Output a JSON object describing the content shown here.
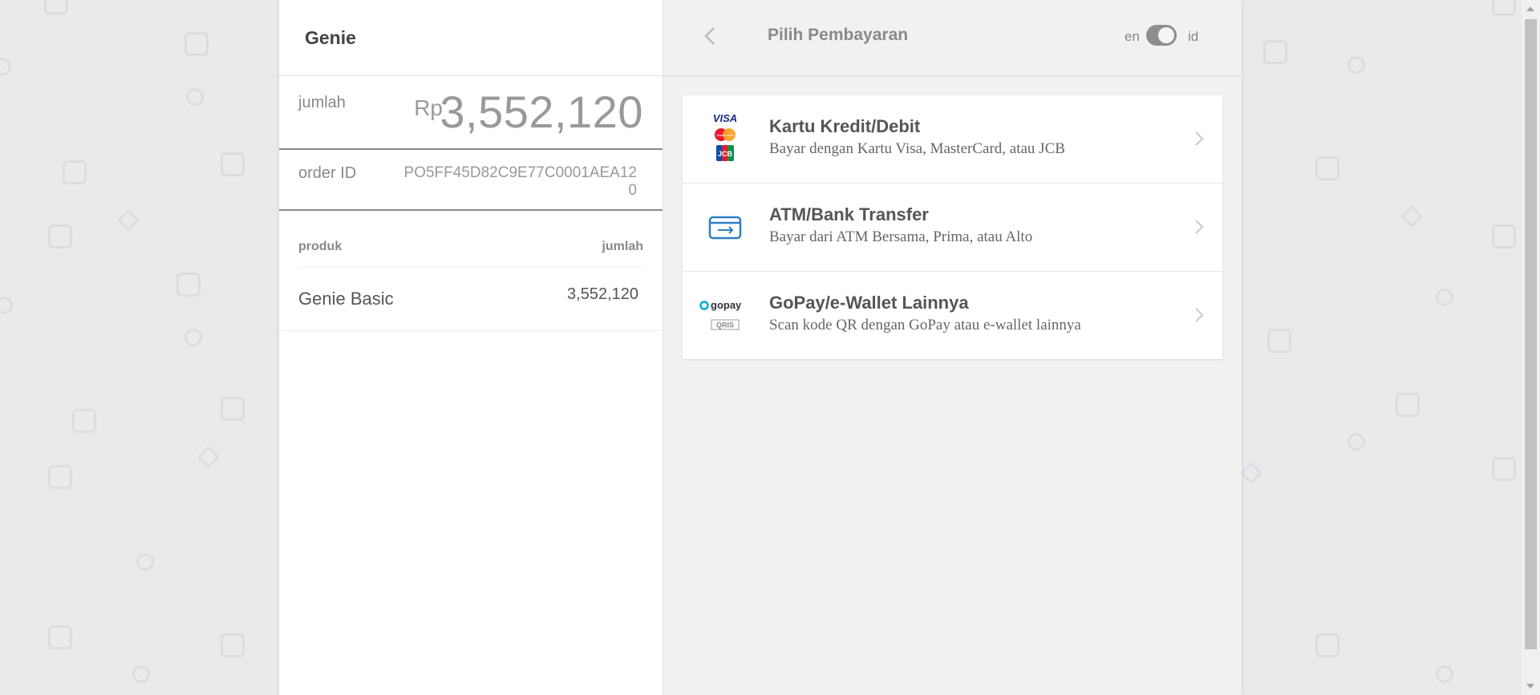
{
  "merchant": {
    "name": "Genie"
  },
  "summary": {
    "amount_label": "jumlah",
    "currency": "Rp",
    "amount": "3,552,120",
    "order_label": "order ID",
    "order_id": "PO5FF45D82C9E77C0001AEA120"
  },
  "products": {
    "header_product": "produk",
    "header_amount": "jumlah",
    "items": [
      {
        "name": "Genie Basic",
        "amount": "3,552,120"
      }
    ]
  },
  "payment_page": {
    "title": "Pilih Pembayaran",
    "lang_en": "en",
    "lang_id": "id"
  },
  "payment_methods": [
    {
      "title": "Kartu Kredit/Debit",
      "desc": "Bayar dengan Kartu Visa, MasterCard, atau JCB",
      "icon": "card-brands-icon"
    },
    {
      "title": "ATM/Bank Transfer",
      "desc": "Bayar dari ATM Bersama, Prima, atau Alto",
      "icon": "bank-transfer-icon"
    },
    {
      "title": "GoPay/e-Wallet Lainnya",
      "desc": "Scan kode QR dengan GoPay atau e-wallet lainnya",
      "icon": "gopay-qris-icon"
    }
  ],
  "logos": {
    "visa": "VISA",
    "mastercard": "MasterCard",
    "jcb": "JCB",
    "gopay": "gopay",
    "qris": "QRIS"
  },
  "colors": {
    "accent_blue": "#2f7fc3",
    "toggle": "#8e8e8e",
    "panel_bg": "#f1f1f1"
  }
}
